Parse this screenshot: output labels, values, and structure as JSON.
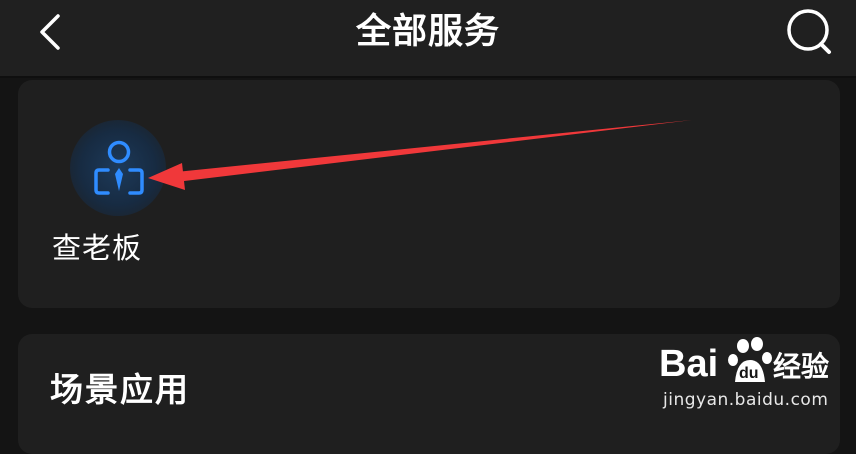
{
  "header": {
    "title": "全部服务",
    "back_icon": "chevron-left-icon",
    "search_icon": "search-icon"
  },
  "services": {
    "items": [
      {
        "label": "查老板",
        "icon": "boss-person-icon"
      }
    ]
  },
  "scene": {
    "title": "场景应用"
  },
  "watermark": {
    "logo_text": "Bai du 经验",
    "url": "jingyan.baidu.com"
  },
  "colors": {
    "background": "#141414",
    "card": "#1f1f1f",
    "icon_blue": "#2f8cff",
    "arrow_red": "#f0383a"
  }
}
